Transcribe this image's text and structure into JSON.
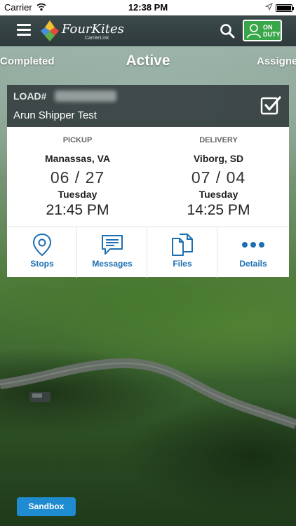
{
  "status_bar": {
    "carrier": "Carrier",
    "time": "12:38 PM"
  },
  "navbar": {
    "brand": "FourKites",
    "brand_sub": "CarrierLink",
    "duty_label": "ON DUTY"
  },
  "tabs": {
    "completed": "Completed",
    "active": "Active",
    "assigned": "Assigned"
  },
  "load": {
    "label": "LOAD#",
    "shipper": "Arun Shipper Test",
    "pickup": {
      "header": "PICKUP",
      "city": "Manassas, VA",
      "date": "06 / 27",
      "day": "Tuesday",
      "time": "21:45 PM"
    },
    "delivery": {
      "header": "DELIVERY",
      "city": "Viborg, SD",
      "date": "07 / 04",
      "day": "Tuesday",
      "time": "14:25 PM"
    },
    "actions": [
      {
        "label": "Stops",
        "icon": "map-pin-icon"
      },
      {
        "label": "Messages",
        "icon": "chat-icon"
      },
      {
        "label": "Files",
        "icon": "files-icon"
      },
      {
        "label": "Details",
        "icon": "more-dots-icon"
      }
    ]
  },
  "footer": {
    "sandbox_label": "Sandbox"
  },
  "colors": {
    "accent_blue": "#1d6fb3",
    "duty_green": "#3aa64a",
    "navbar": "#3c4a4c"
  }
}
